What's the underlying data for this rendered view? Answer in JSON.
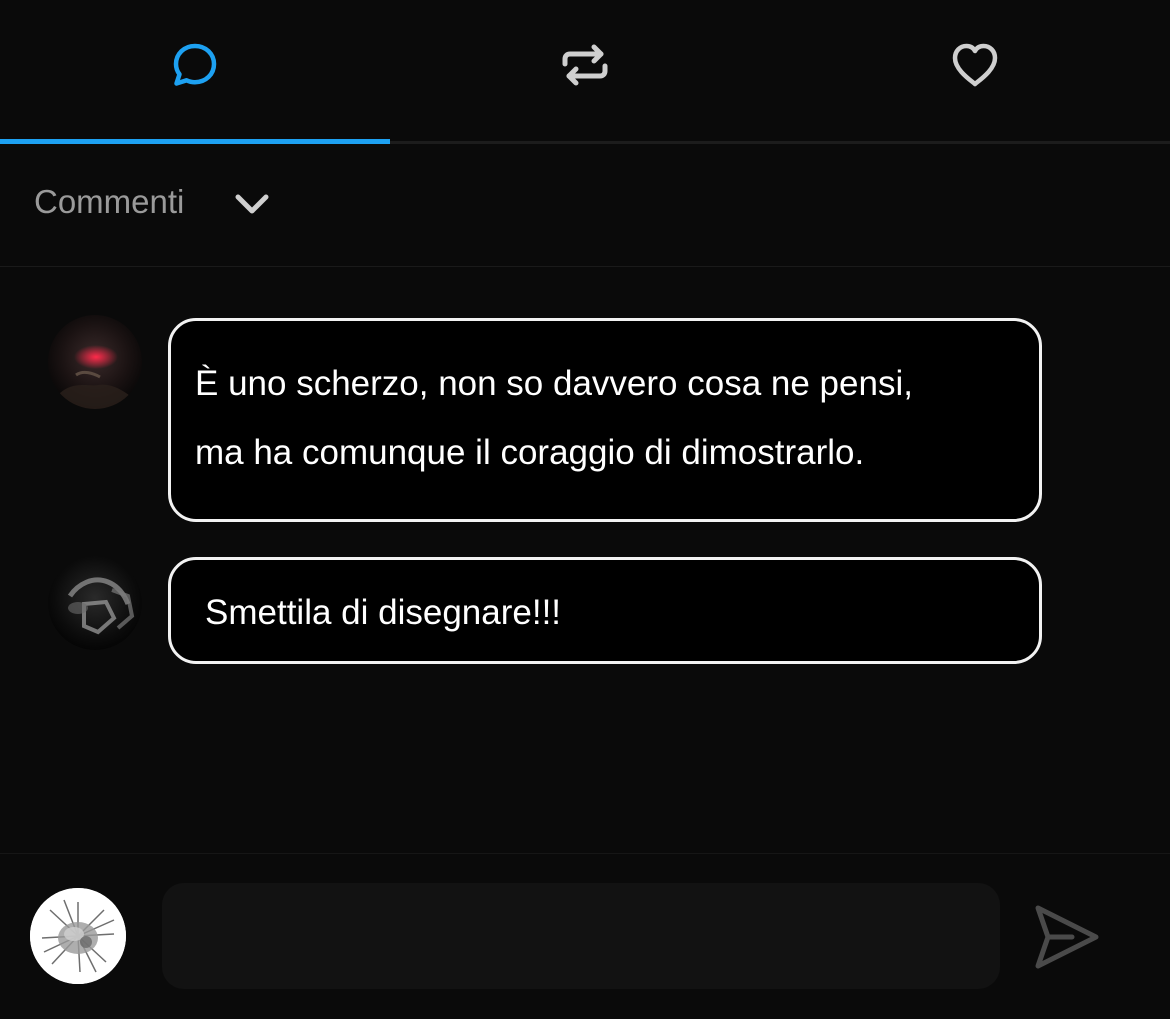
{
  "tabs": [
    {
      "id": "comments",
      "icon": "comment-icon",
      "active": true
    },
    {
      "id": "reposts",
      "icon": "repost-icon",
      "active": false
    },
    {
      "id": "likes",
      "icon": "heart-icon",
      "active": false
    }
  ],
  "comments_section": {
    "title": "Commenti",
    "dropdown_icon": "chevron-down-icon"
  },
  "comments": [
    {
      "text": "È uno scherzo, non so davvero cosa ne pensi,\nma ha comunque il coraggio di dimostrarlo."
    },
    {
      "text": "Smettila di disegnare!!!"
    }
  ],
  "composer": {
    "placeholder": "",
    "send_icon": "send-icon"
  },
  "colors": {
    "accent": "#1da1f2",
    "background": "#0a0a0a",
    "bubble_border": "#f2f2f2",
    "muted_text": "#9a9a9a"
  }
}
